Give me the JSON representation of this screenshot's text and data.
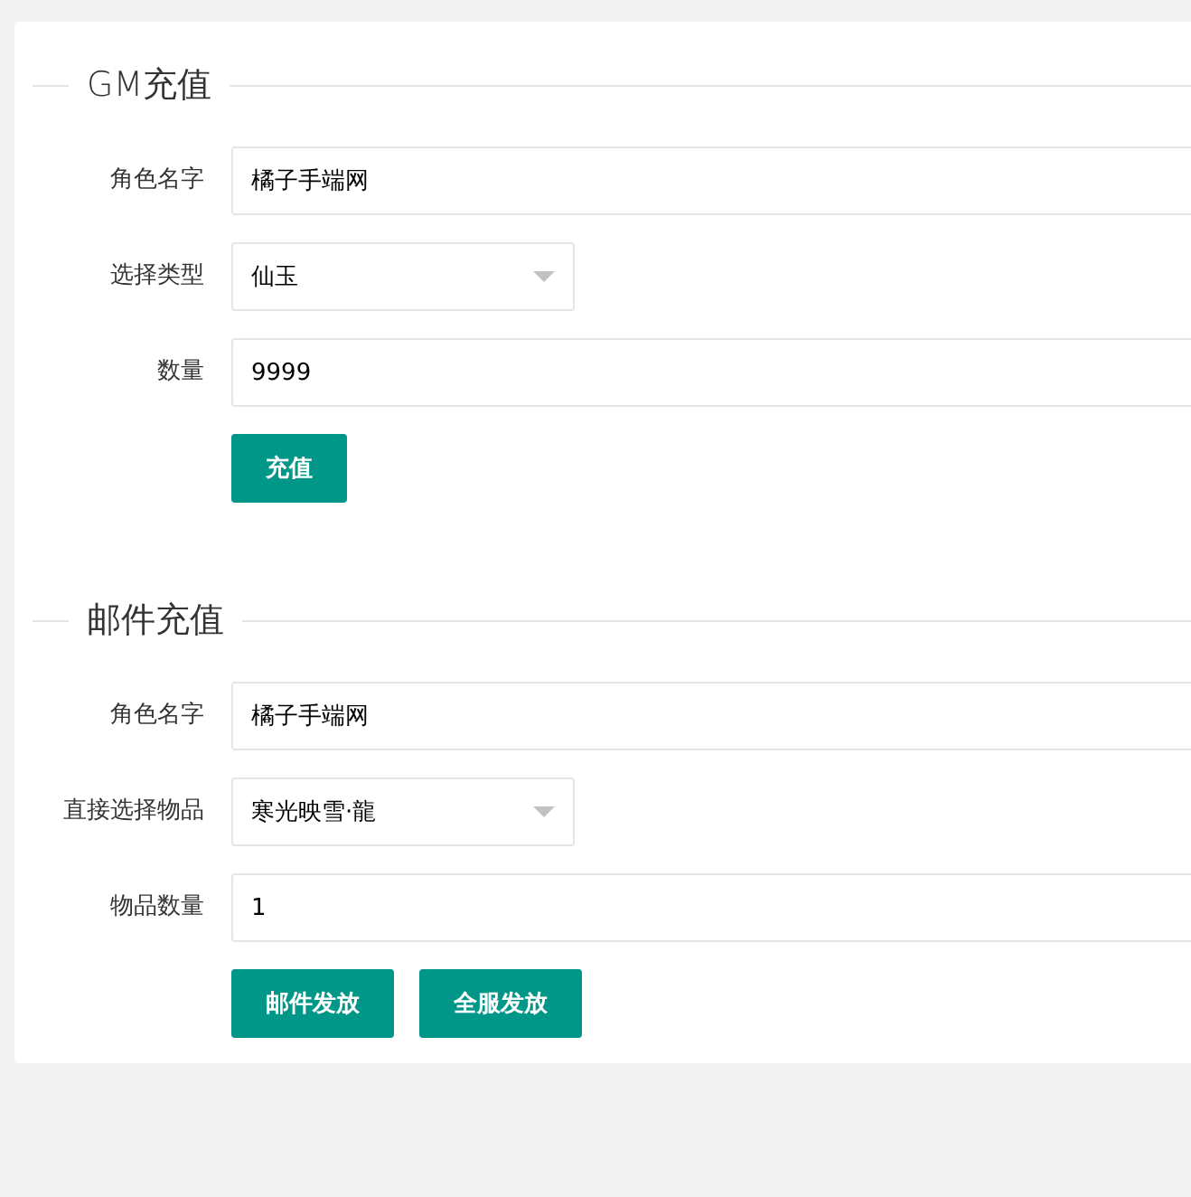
{
  "sections": [
    {
      "title": "GM充值",
      "fields": [
        {
          "kind": "text",
          "label": "角色名字",
          "value": "橘子手端网"
        },
        {
          "kind": "select",
          "label": "选择类型",
          "value": "仙玉"
        },
        {
          "kind": "text",
          "label": "数量",
          "value": "9999"
        }
      ],
      "buttons": [
        "充值"
      ]
    },
    {
      "title": "邮件充值",
      "fields": [
        {
          "kind": "text",
          "label": "角色名字",
          "value": "橘子手端网"
        },
        {
          "kind": "select",
          "label": "直接选择物品",
          "value": "寒光映雪·龍"
        },
        {
          "kind": "text",
          "label": "物品数量",
          "value": "1"
        }
      ],
      "buttons": [
        "邮件发放",
        "全服发放"
      ]
    }
  ]
}
